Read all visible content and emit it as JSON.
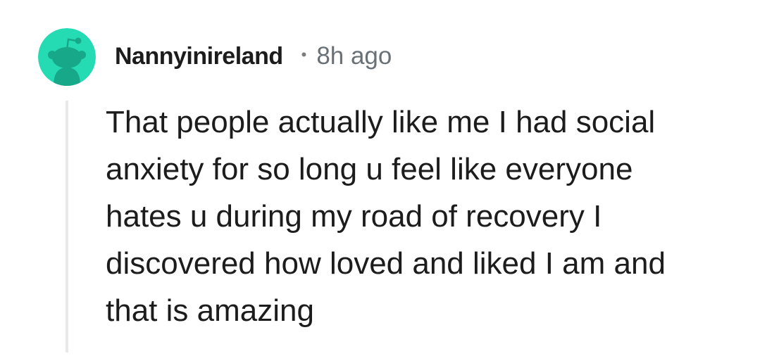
{
  "comment": {
    "username": "Nannyinireland",
    "separator": "•",
    "time": "8h ago",
    "text": "That people actually like me I had social\nanxiety for so long u feel like everyone\nhates u during my road of recovery I\ndiscovered how loved and liked I am and\nthat is amazing",
    "avatar": {
      "icon": "snoo-avatar-icon",
      "background_color": "#24dbb4",
      "figure_color": "#17a88a"
    }
  }
}
